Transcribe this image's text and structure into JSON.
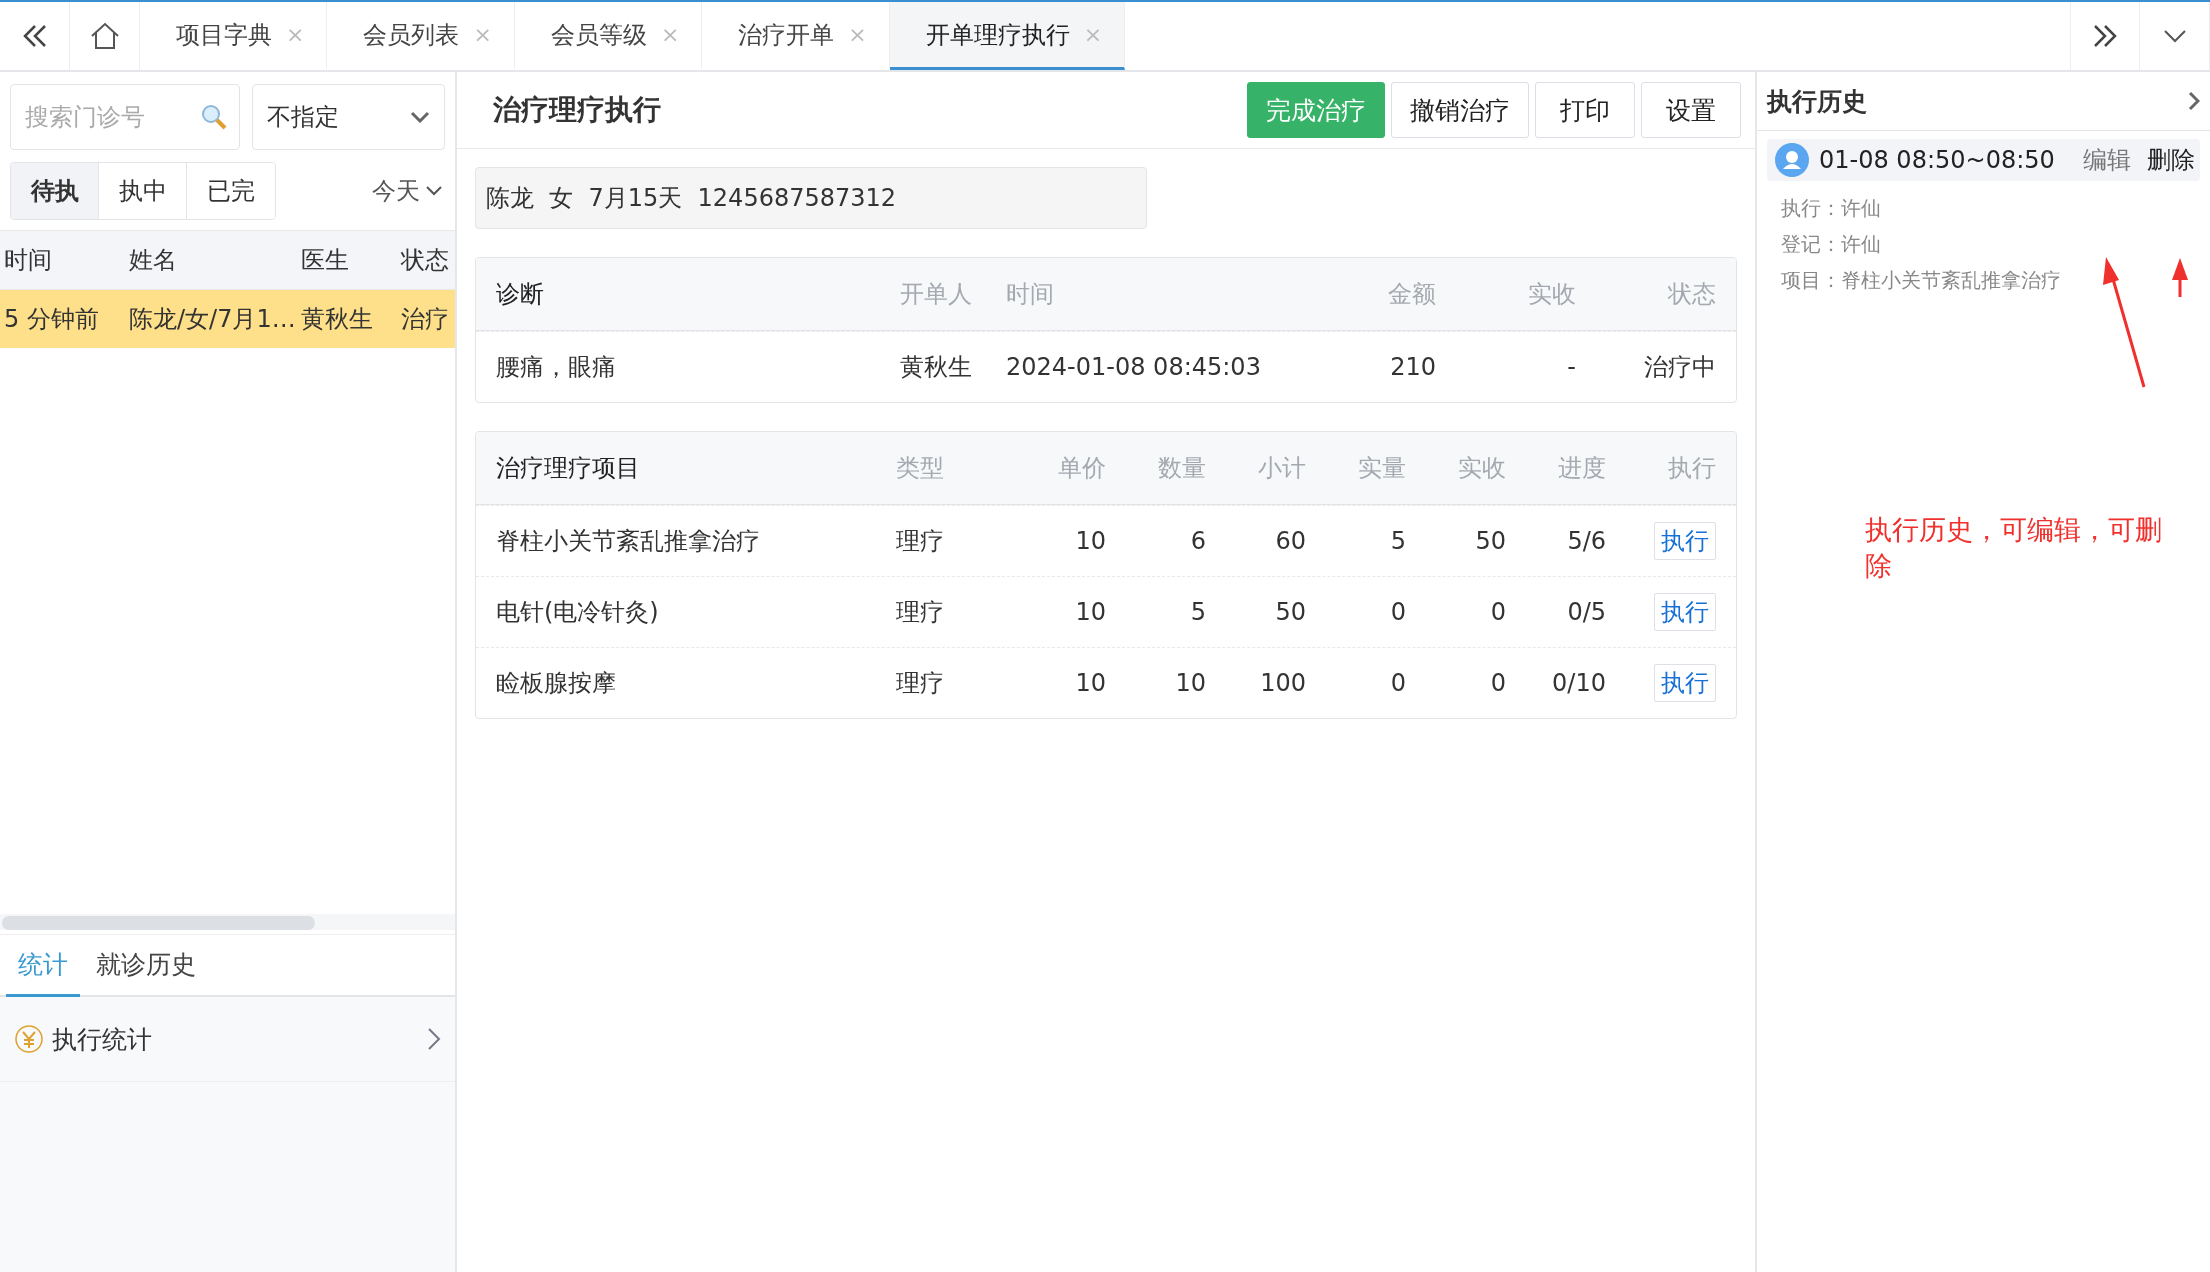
{
  "tabbar": {
    "tabs": [
      {
        "label": "项目字典",
        "selected": false,
        "close": "×"
      },
      {
        "label": "会员列表",
        "selected": false,
        "close": "×"
      },
      {
        "label": "会员等级",
        "selected": false,
        "close": "×"
      },
      {
        "label": "治疗开单",
        "selected": false,
        "close": "×"
      },
      {
        "label": "开单理疗执行",
        "selected": true,
        "close": "×"
      }
    ]
  },
  "left": {
    "search": {
      "placeholder": "搜索门诊号"
    },
    "select": {
      "value": "不指定"
    },
    "filters": [
      {
        "label": "待执",
        "selected": true
      },
      {
        "label": "执中",
        "selected": false
      },
      {
        "label": "已完",
        "selected": false
      }
    ],
    "date_filter": "今天",
    "columns": [
      "时间",
      "姓名",
      "医生",
      "状态"
    ],
    "rows": [
      {
        "cells": [
          "5 分钟前",
          "陈龙/女/7月1…",
          "黄秋生",
          "治疗"
        ],
        "selected": true
      }
    ],
    "bottom_tabs": [
      {
        "label": "统计",
        "selected": true
      },
      {
        "label": "就诊历史",
        "selected": false
      }
    ],
    "stat_items": [
      {
        "label": "执行统计"
      }
    ]
  },
  "main": {
    "title": "治疗理疗执行",
    "buttons": [
      {
        "label": "完成治疗",
        "kind": "primary"
      },
      {
        "label": "撤销治疗",
        "kind": "default"
      },
      {
        "label": "打印",
        "kind": "default"
      },
      {
        "label": "设置",
        "kind": "default"
      }
    ],
    "patient_info": "陈龙  女  7月15天  1245687587312",
    "diagnosis": {
      "columns": [
        "诊断",
        "开单人",
        "时间",
        "金额",
        "实收",
        "状态"
      ],
      "rows": [
        [
          "腰痛，眼痛",
          "黄秋生",
          "2024-01-08 08:45:03",
          "210",
          "-",
          "治疗中"
        ]
      ]
    },
    "items": {
      "columns": [
        "治疗理疗项目",
        "类型",
        "单价",
        "数量",
        "小计",
        "实量",
        "实收",
        "进度",
        "执行"
      ],
      "rows": [
        {
          "cells": [
            "脊柱小关节紊乱推拿治疗",
            "理疗",
            "10",
            "6",
            "60",
            "5",
            "50",
            "5/6"
          ],
          "action": "执行"
        },
        {
          "cells": [
            "电针(电冷针灸)",
            "理疗",
            "10",
            "5",
            "50",
            "0",
            "0",
            "0/5"
          ],
          "action": "执行"
        },
        {
          "cells": [
            "睑板腺按摩",
            "理疗",
            "10",
            "10",
            "100",
            "0",
            "0",
            "0/10"
          ],
          "action": "执行"
        }
      ]
    }
  },
  "right": {
    "title": "执行历史",
    "records": [
      {
        "time": "01-08 08:50~08:50",
        "edit": "编辑",
        "delete": "删除",
        "details": [
          "执行：许仙",
          "登记：许仙",
          "项目：脊柱小关节紊乱推拿治疗"
        ]
      }
    ]
  },
  "annotation": {
    "text": "执行历史，可编辑，可删除"
  }
}
